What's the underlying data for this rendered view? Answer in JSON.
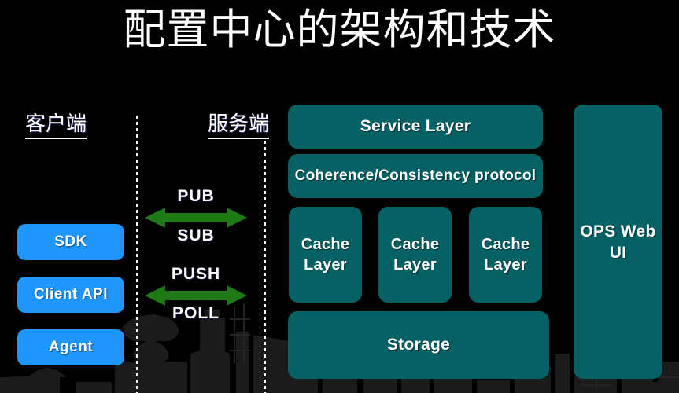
{
  "slide": {
    "title": "配置中心的架构和技术",
    "background_color": "#000000",
    "accent_blue": "#1e96fb",
    "accent_teal": "#056164",
    "accent_green": "#1e7a14",
    "text_color": "#ffffff"
  },
  "sections": {
    "client_label": "客户端",
    "server_label": "服务端"
  },
  "client_boxes": [
    {
      "label": "SDK"
    },
    {
      "label": "Client  API"
    },
    {
      "label": "Agent"
    }
  ],
  "arrows": [
    {
      "top_label": "PUB",
      "bottom_label": "SUB",
      "color": "#1e7a14",
      "direction": "bidirectional"
    },
    {
      "top_label": "PUSH",
      "bottom_label": "POLL",
      "color": "#1e7a14",
      "direction": "bidirectional"
    }
  ],
  "server_boxes": {
    "service_layer": "Service Layer",
    "coherence": "Coherence/Consistency protocol",
    "cache_1": "Cache Layer",
    "cache_2": "Cache Layer",
    "cache_3": "Cache Layer",
    "storage": "Storage"
  },
  "ops_panel": {
    "label": "OPS Web UI"
  }
}
